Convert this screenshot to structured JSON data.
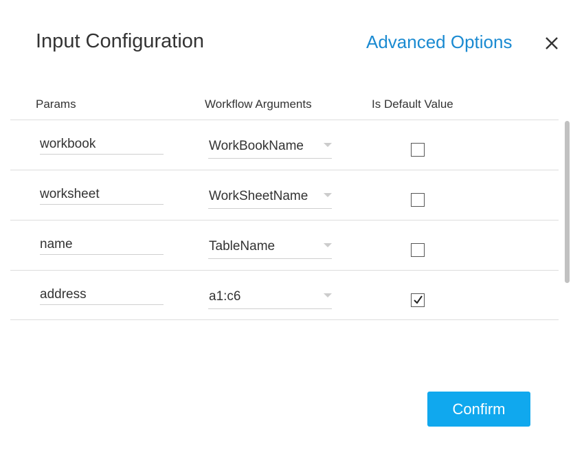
{
  "dialog": {
    "title": "Input Configuration",
    "advanced_link": "Advanced Options",
    "close_icon": "close-icon"
  },
  "table": {
    "headers": {
      "params": "Params",
      "args": "Workflow Arguments",
      "default": "Is Default Value"
    },
    "rows": [
      {
        "param": "workbook",
        "arg": "WorkBookName",
        "is_default": false
      },
      {
        "param": "worksheet",
        "arg": "WorkSheetName",
        "is_default": false
      },
      {
        "param": "name",
        "arg": "TableName",
        "is_default": false
      },
      {
        "param": "address",
        "arg": "a1:c6",
        "is_default": true
      }
    ]
  },
  "footer": {
    "confirm_label": "Confirm"
  },
  "colors": {
    "accent_link": "#1a8ad1",
    "confirm_bg": "#10a8ee",
    "divider": "#dddddd"
  }
}
